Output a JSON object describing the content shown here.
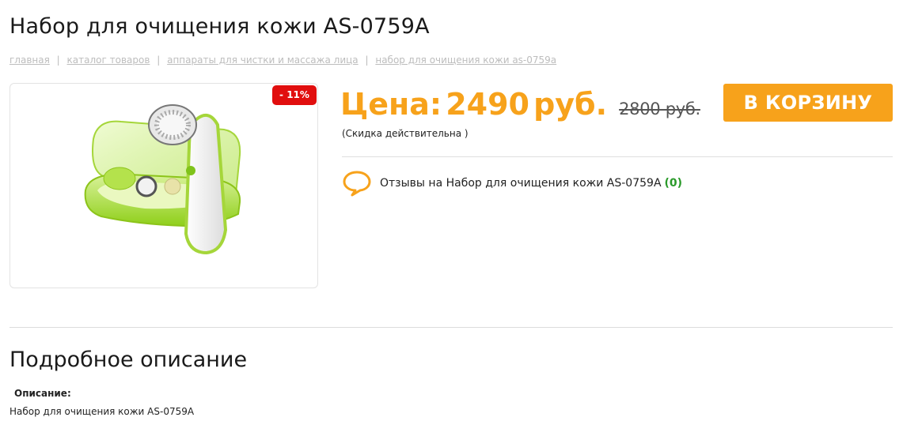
{
  "product": {
    "title": "Набор для очищения кожи AS-0759A",
    "discount_badge": "- 11%",
    "image_alt": "Набор для очищения кожи AS-0759A"
  },
  "breadcrumb": [
    {
      "label": "главная"
    },
    {
      "label": "каталог товаров"
    },
    {
      "label": "аппараты для чистки и массажа лица"
    },
    {
      "label": "набор для очищения кожи as-0759a"
    }
  ],
  "breadcrumb_separator": "|",
  "price": {
    "label": "Цена:",
    "value": "2490",
    "currency": "руб.",
    "old_price": "2800 руб.",
    "note": "(Скидка действительна )"
  },
  "cart_button": {
    "label": "В КОРЗИНУ"
  },
  "reviews": {
    "text": "Отзывы на Набор для очищения кожи AS-0759A",
    "count": "(0)"
  },
  "description": {
    "section_title": "Подробное описание",
    "label": "Описание:",
    "text": "Набор для очищения кожи AS-0759A"
  },
  "colors": {
    "accent": "#f7a21b",
    "badge": "#e10e0e",
    "count_green": "#2a9a2a",
    "product_green": "#9fd62a"
  }
}
